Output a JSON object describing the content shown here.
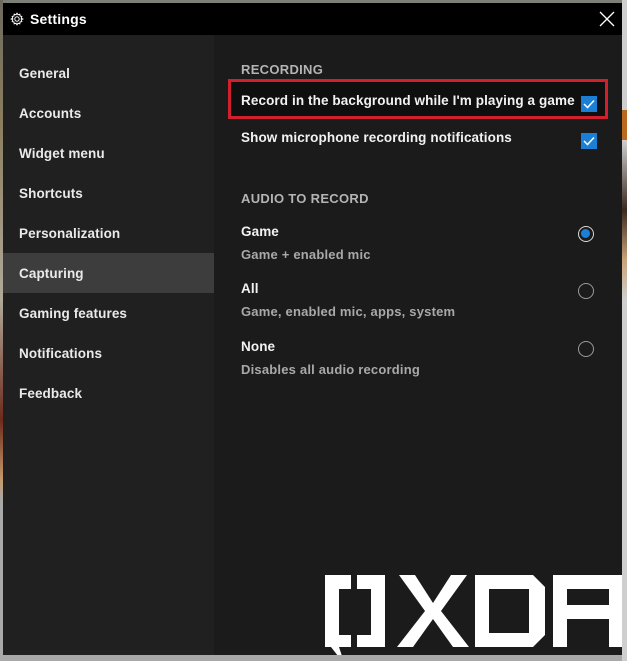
{
  "window": {
    "title": "Settings",
    "title_icon": "gear-icon",
    "close_icon": "close-icon"
  },
  "sidebar": {
    "items": [
      {
        "label": "General",
        "active": false
      },
      {
        "label": "Accounts",
        "active": false
      },
      {
        "label": "Widget menu",
        "active": false
      },
      {
        "label": "Shortcuts",
        "active": false
      },
      {
        "label": "Personalization",
        "active": false
      },
      {
        "label": "Capturing",
        "active": true
      },
      {
        "label": "Gaming features",
        "active": false
      },
      {
        "label": "Notifications",
        "active": false
      },
      {
        "label": "Feedback",
        "active": false
      }
    ]
  },
  "content": {
    "recording": {
      "header": "RECORDING",
      "options": [
        {
          "label": "Record in the background while I'm playing a game",
          "checked": true,
          "highlighted": true
        },
        {
          "label": "Show microphone recording notifications",
          "checked": true,
          "highlighted": false
        }
      ]
    },
    "audio": {
      "header": "AUDIO TO RECORD",
      "options": [
        {
          "title": "Game",
          "description": "Game + enabled mic",
          "selected": true
        },
        {
          "title": "All",
          "description": "Game, enabled mic, apps, system",
          "selected": false
        },
        {
          "title": "None",
          "description": "Disables all audio recording",
          "selected": false
        }
      ]
    }
  },
  "colors": {
    "accent": "#1c7fd6",
    "highlight_border": "#d0202e",
    "titlebar": "#000000",
    "sidebar": "#202020",
    "sidebar_active": "#3d3d3d",
    "content": "#1b1b1b"
  },
  "watermark": {
    "text": "XDA"
  }
}
